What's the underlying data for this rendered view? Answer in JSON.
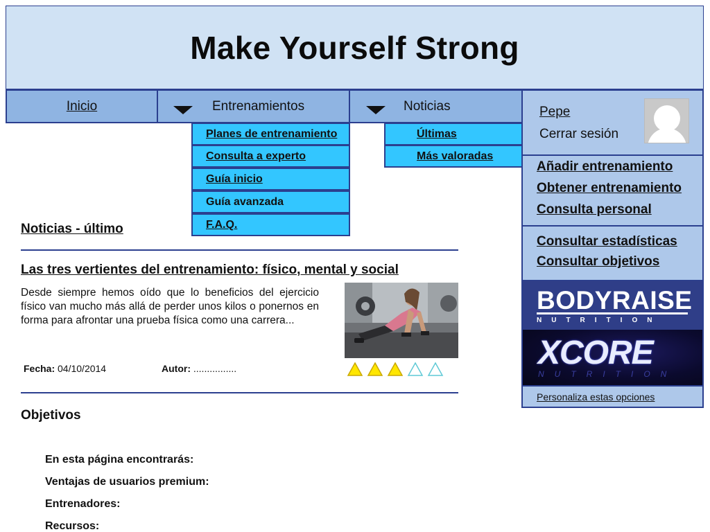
{
  "header": {
    "title": "Make Yourself Strong"
  },
  "nav": {
    "inicio": "Inicio",
    "entrenamientos": "Entrenamientos",
    "noticias": "Noticias"
  },
  "dropdown_entrenamientos": [
    "Planes de entrenamiento",
    "Consulta a experto",
    "Guía inicio",
    "Guía avanzada",
    "F.A.Q."
  ],
  "dropdown_noticias": [
    "Últimas",
    "Más valoradas"
  ],
  "user": {
    "name": "Pepe",
    "logout": "Cerrar sesión"
  },
  "sidebar": {
    "group1": [
      "Añadir entrenamiento",
      "Obtener entrenamiento",
      "Consulta personal"
    ],
    "group2": [
      "Consultar estadísticas",
      "Consultar objetivos"
    ],
    "ads": {
      "bodyraise_brand": "BODYRAISE",
      "bodyraise_sub": "NUTRITION",
      "xcore_brand": "XCORE",
      "xcore_sub": "NUTRITION"
    },
    "customize": "Personaliza estas opciones"
  },
  "main": {
    "section_title": "Noticias - último",
    "article": {
      "title": "Las tres vertientes del entrenamiento: físico, mental y social",
      "excerpt": "Desde siempre hemos oído que lo beneficios del ejercicio físico van mucho más allá de perder unos kilos o ponernos en forma para afrontar una prueba física como una carrera...",
      "fecha_label": "Fecha:",
      "fecha_value": "04/10/2014",
      "autor_label": "Autor:",
      "autor_value": "................",
      "rating": 3,
      "rating_max": 5
    },
    "objetivos": {
      "title": "Objetivos",
      "items": [
        "En esta página encontrarás:",
        "Ventajas de usuarios premium:",
        "Entrenadores:",
        "Recursos:"
      ]
    }
  },
  "colors": {
    "header_bg": "#d0e2f4",
    "nav_bg": "#8fb4e2",
    "dropdown_bg": "#33c6ff",
    "panel_bg": "#aec8ea",
    "border": "#2b3f8f",
    "star_filled": "#ffe600",
    "star_empty_stroke": "#5fc9d6"
  }
}
